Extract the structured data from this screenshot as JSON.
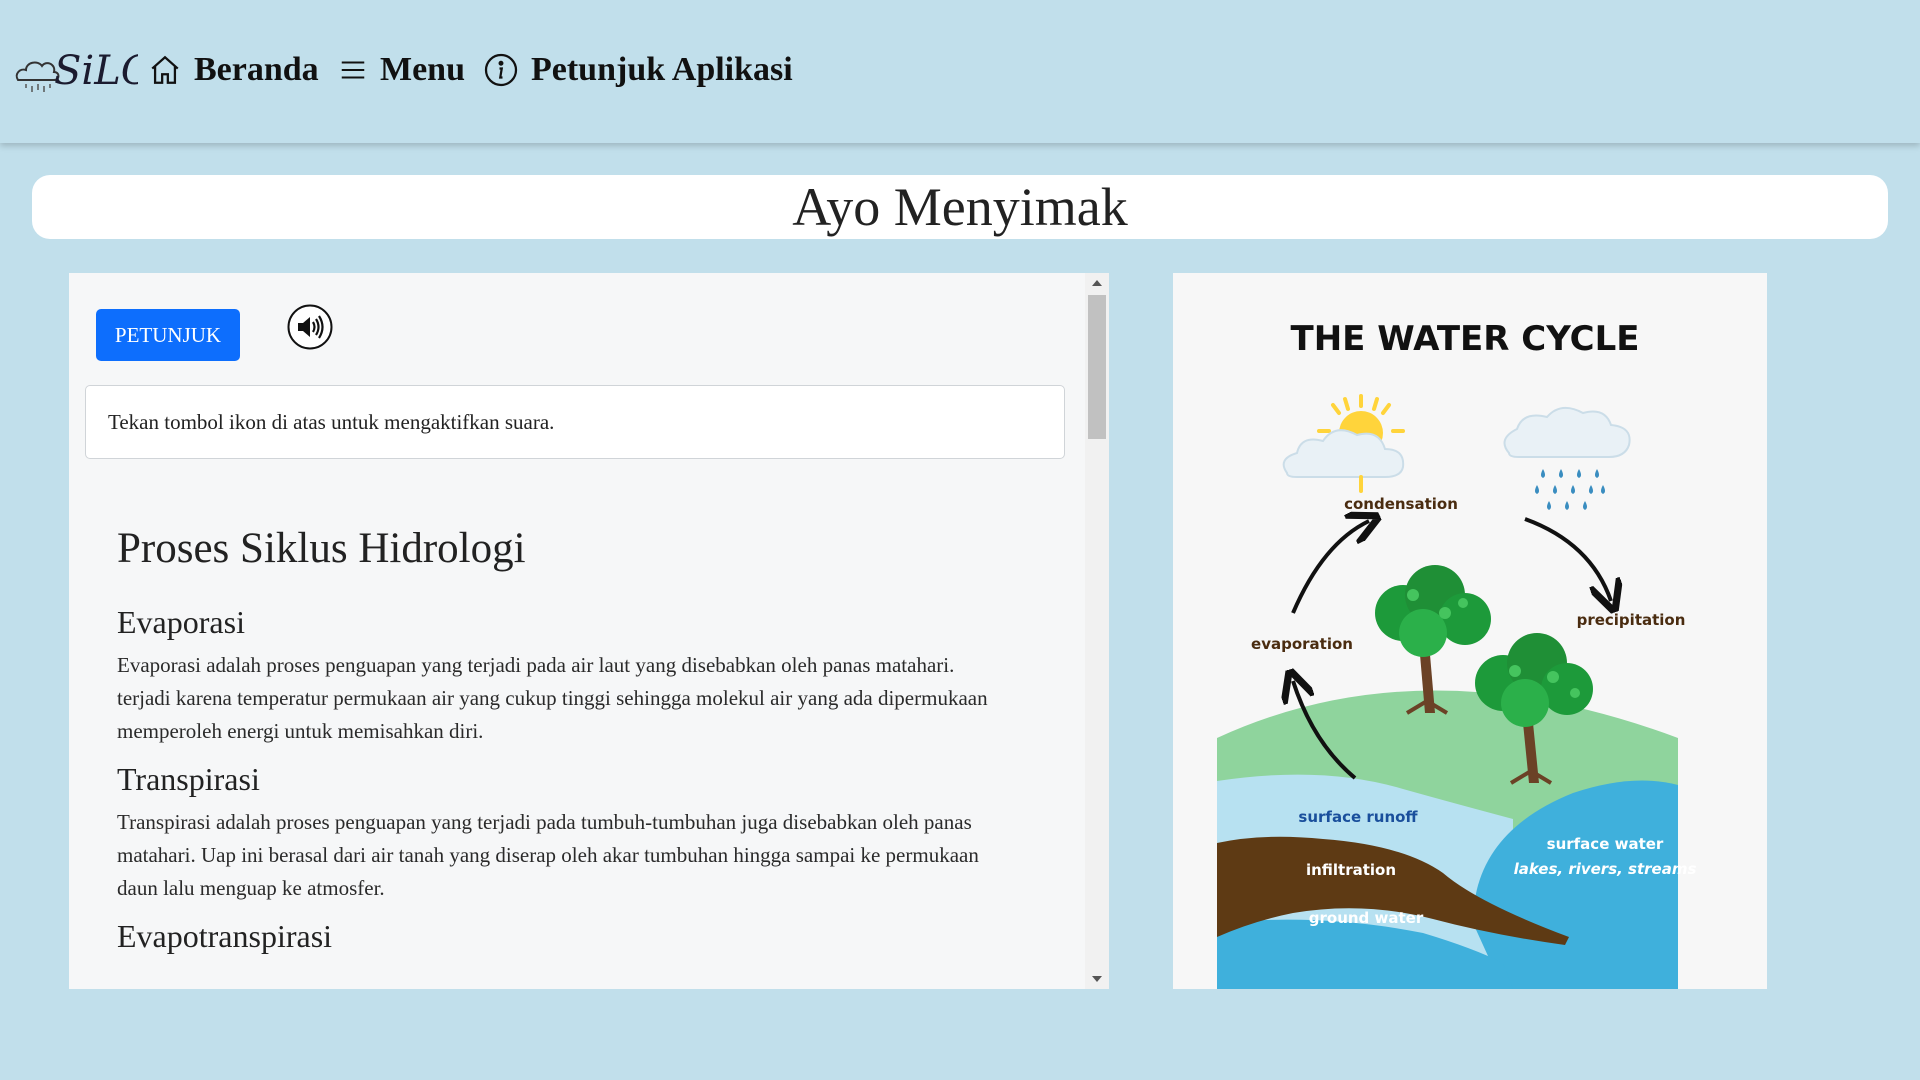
{
  "navbar": {
    "logo_text": "SiLO",
    "home_label": "Beranda",
    "menu_label": "Menu",
    "guide_label": "Petunjuk Aplikasi"
  },
  "page": {
    "title": "Ayo Menyimak"
  },
  "left_panel": {
    "petunjuk_button": "PETUNJUK",
    "sound_icon": "speaker-volume-icon",
    "info_text": "Tekan tombol ikon di atas untuk mengaktifkan suara.",
    "heading": "Proses Siklus Hidrologi",
    "sections": [
      {
        "title": "Evaporasi",
        "lines": [
          "Evaporasi adalah proses penguapan yang terjadi pada air laut yang disebabkan oleh panas matahari.",
          "terjadi karena temperatur permukaan air yang cukup tinggi sehingga molekul air yang ada dipermukaan",
          "memperoleh energi untuk memisahkan diri."
        ]
      },
      {
        "title": "Transpirasi",
        "lines": [
          "Transpirasi adalah proses penguapan yang terjadi pada tumbuh-tumbuhan juga disebabkan oleh panas",
          "matahari. Uap ini berasal dari air tanah yang diserap oleh akar tumbuhan hingga sampai ke permukaan",
          "daun lalu menguap ke atmosfer."
        ]
      },
      {
        "title": "Evapotranspirasi"
      }
    ]
  },
  "diagram": {
    "title": "THE WATER CYCLE",
    "labels": {
      "condensation": "condensation",
      "evaporation": "evaporation",
      "precipitation": "precipitation",
      "surface_runoff": "surface runoff",
      "surface_water": "surface water",
      "surface_water_sub": "lakes, rivers, streams",
      "infiltration": "infiltration",
      "ground_water": "ground water"
    },
    "colors": {
      "hill": "#8fd49d",
      "surface_runoff": "#b7e1f1",
      "soil": "#5e3a14",
      "water": "#3fb0dc",
      "sun": "#ffd43b",
      "rain": "#3a8dc0",
      "tree": "#1d9a3a",
      "trunk": "#6b4226",
      "label_dark": "#4a2c10",
      "label_blue": "#1a4f9c"
    }
  }
}
